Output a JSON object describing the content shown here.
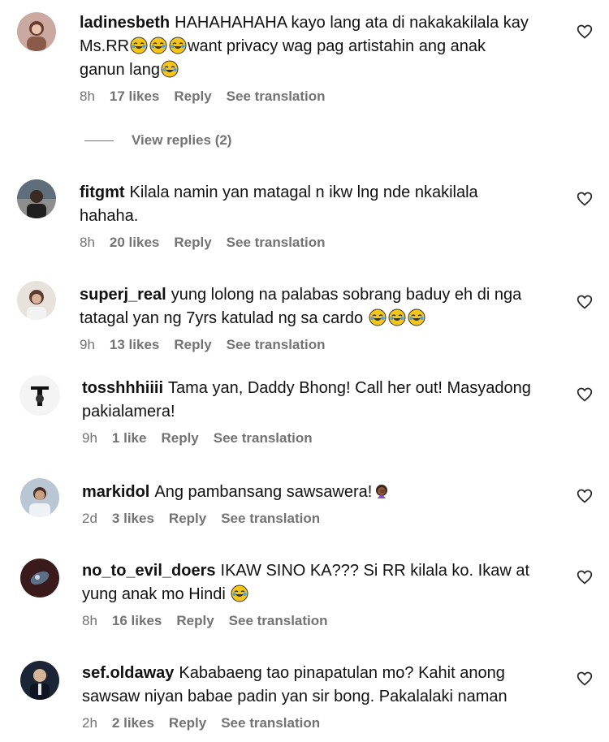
{
  "comments": [
    {
      "username": "ladinesbeth",
      "text_parts": [
        "HAHAHAHAHA kayo lang ata di nakakakilala kay Ms.RR",
        "",
        "",
        "want privacy wag pag artistahin ang anak ganun lang",
        ""
      ],
      "time": "8h",
      "likes": "17 likes",
      "reply": "Reply",
      "translate": "See translation",
      "view_replies": "View replies (2)"
    },
    {
      "username": "fitgmt",
      "text": "Kilala namin yan matagal n ikw lng nde nkakilala hahaha.",
      "time": "8h",
      "likes": "20 likes",
      "reply": "Reply",
      "translate": "See translation"
    },
    {
      "username": "superj_real",
      "text": "yung lolong na palabas sobrang baduy eh di nga tatagal yan ng 7yrs katulad ng sa cardo",
      "time": "9h",
      "likes": "13 likes",
      "reply": "Reply",
      "translate": "See translation"
    },
    {
      "username": "tosshhhiiii",
      "text": "Tama yan, Daddy Bhong! Call her out! Masyadong pakialamera!",
      "time": "9h",
      "likes": "1 like",
      "reply": "Reply",
      "translate": "See translation"
    },
    {
      "username": "markidol",
      "text": "Ang pambansang sawsawera!",
      "time": "2d",
      "likes": "3 likes",
      "reply": "Reply",
      "translate": "See translation"
    },
    {
      "username": "no_to_evil_doers",
      "text": "IKAW SINO KA??? Si RR kilala ko. Ikaw at yung anak mo Hindi",
      "time": "8h",
      "likes": "16 likes",
      "reply": "Reply",
      "translate": "See translation"
    },
    {
      "username": "sef.oldaway",
      "text": "Kababaeng tao pinapatulan mo? Kahit anong sawsaw niyan babae padin yan sir bong. Pakalalaki naman",
      "time": "2h",
      "likes": "2 likes",
      "reply": "Reply",
      "translate": "See translation"
    }
  ],
  "icons": {
    "heart": "heart-outline-icon",
    "laugh": "face-with-tears-of-joy-icon",
    "facepalm": "woman-facepalming-icon"
  },
  "colors": {
    "meta": "#737373",
    "text": "#111111"
  }
}
